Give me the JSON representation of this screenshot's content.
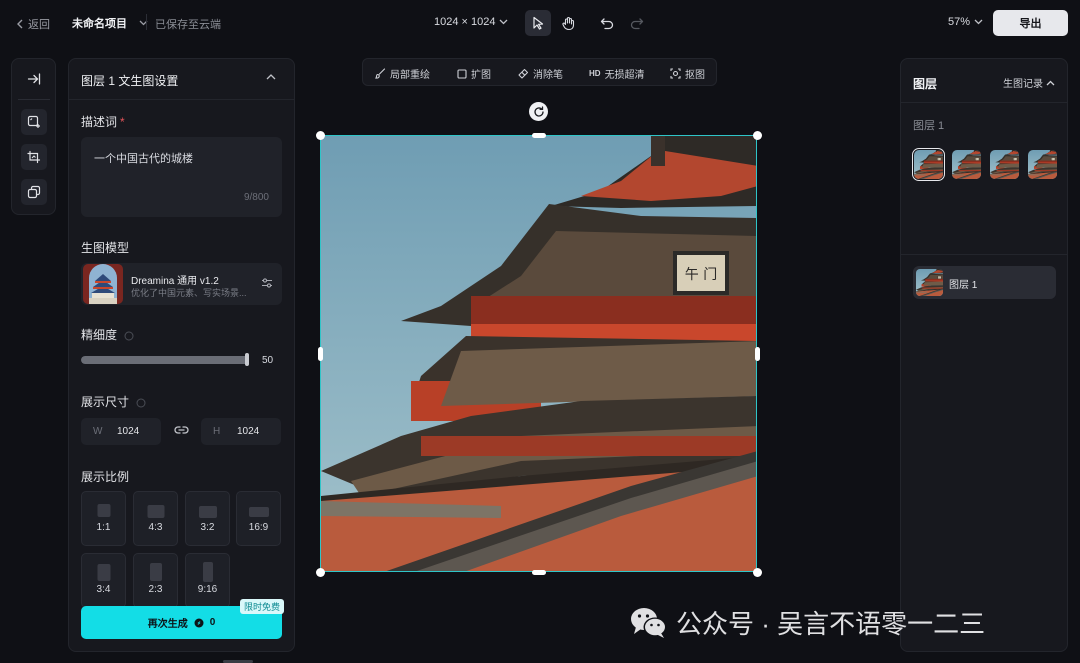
{
  "topbar": {
    "back_label": "返回",
    "project_name": "未命名项目",
    "save_status": "已保存至云端",
    "canvas_size": "1024 × 1024",
    "zoom": "57%",
    "export_label": "导出"
  },
  "left_panel": {
    "header": "图层 1 文生图设置",
    "prompt_label": "描述词",
    "prompt_required": "*",
    "prompt_text": "一个中国古代的城楼",
    "prompt_count": "9/800",
    "model_label": "生图模型",
    "model_name": "Dreamina 通用 v1.2",
    "model_desc": "优化了中国元素、写实场景...",
    "detail_label": "精细度",
    "detail_value": "50",
    "detail_fraction": 1.0,
    "size_label": "展示尺寸",
    "width_label": "W",
    "width_value": "1024",
    "height_label": "H",
    "height_value": "1024",
    "ratio_label": "展示比例",
    "ratios": [
      "1:1",
      "4:3",
      "3:2",
      "16:9",
      "3:4",
      "2:3",
      "9:16"
    ],
    "generate_label": "再次生成",
    "generate_cost": "0",
    "generate_badge": "限时免费"
  },
  "edit_toolbar": {
    "items": [
      "局部重绘",
      "扩图",
      "消除笔",
      "无损超清",
      "抠图"
    ],
    "hd_prefix": "HD"
  },
  "right_panel": {
    "title": "图层",
    "history_label": "生图记录",
    "results_label": "图层 1",
    "layer_name": "图层 1"
  },
  "watermark": {
    "text": "公众号 · 吴言不语零一二三"
  },
  "colors": {
    "accent": "#13dde6",
    "selection": "#2ec5c8",
    "background": "#0f1015",
    "panel": "#17181e"
  }
}
